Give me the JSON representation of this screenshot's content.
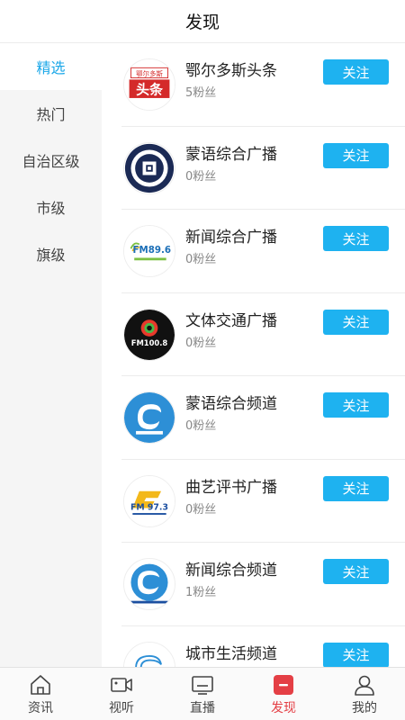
{
  "header": {
    "title": "发现"
  },
  "sidebar": {
    "items": [
      {
        "label": "精选",
        "active": true
      },
      {
        "label": "热门"
      },
      {
        "label": "自治区级"
      },
      {
        "label": "市级"
      },
      {
        "label": "旗级"
      }
    ]
  },
  "channels": [
    {
      "name": "鄂尔多斯头条",
      "fans": "5粉丝",
      "follow": "关注",
      "logo": "ordos-headline-logo",
      "logo_text_top": "鄂尔多斯",
      "logo_text_main": "头条"
    },
    {
      "name": "蒙语综合广播",
      "fans": "0粉丝",
      "follow": "关注",
      "logo": "mongolian-radio-logo"
    },
    {
      "name": "新闻综合广播",
      "fans": "0粉丝",
      "follow": "关注",
      "logo": "fm896-logo",
      "logo_text": "FM89.6"
    },
    {
      "name": "文体交通广播",
      "fans": "0粉丝",
      "follow": "关注",
      "logo": "fm1008-logo",
      "logo_text": "FM100.8"
    },
    {
      "name": "蒙语综合频道",
      "fans": "0粉丝",
      "follow": "关注",
      "logo": "mongolian-tv-logo"
    },
    {
      "name": "曲艺评书广播",
      "fans": "0粉丝",
      "follow": "关注",
      "logo": "fm973-logo",
      "logo_text": "FM 97.3"
    },
    {
      "name": "新闻综合频道",
      "fans": "1粉丝",
      "follow": "关注",
      "logo": "news-tv-logo"
    },
    {
      "name": "城市生活频道",
      "fans": "",
      "follow": "关注",
      "logo": "city-life-logo"
    }
  ],
  "tabbar": {
    "items": [
      {
        "label": "资讯",
        "icon": "home-icon"
      },
      {
        "label": "视听",
        "icon": "video-camera-icon"
      },
      {
        "label": "直播",
        "icon": "tv-icon"
      },
      {
        "label": "发现",
        "icon": "discover-icon",
        "active": true
      },
      {
        "label": "我的",
        "icon": "user-icon"
      }
    ]
  },
  "colors": {
    "accent": "#1aa7e8",
    "follow_button": "#1eb2f0",
    "tab_active": "#e43f45"
  }
}
